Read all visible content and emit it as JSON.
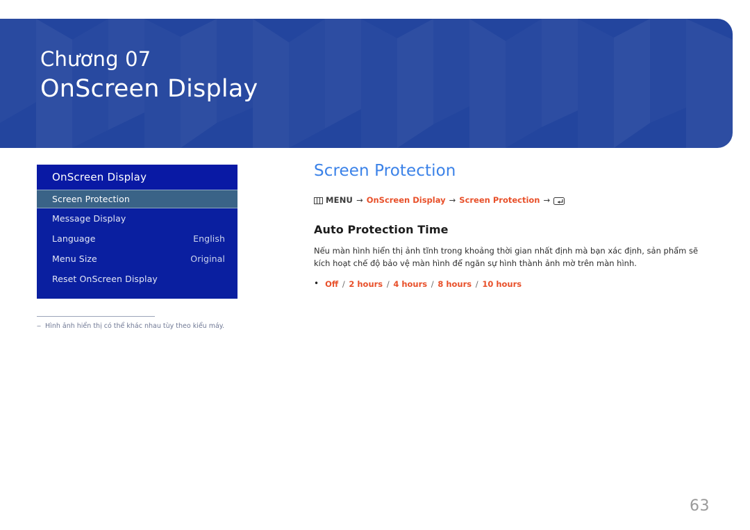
{
  "banner": {
    "chapter_label": "Chương 07",
    "chapter_title": "OnScreen Display",
    "background_color": "#23459e"
  },
  "osd_menu": {
    "header": "OnScreen Display",
    "rows": [
      {
        "label": "Screen Protection",
        "value": "",
        "selected": true
      },
      {
        "label": "Message Display",
        "value": "",
        "selected": false
      },
      {
        "label": "Language",
        "value": "English",
        "selected": false
      },
      {
        "label": "Menu Size",
        "value": "Original",
        "selected": false
      },
      {
        "label": "Reset OnScreen Display",
        "value": "",
        "selected": false
      }
    ],
    "background_color": "#0a1fa0",
    "selected_color": "#3a6387"
  },
  "footnote": {
    "dash": "‒",
    "text": "Hình ảnh hiển thị có thể khác nhau tùy theo kiểu máy."
  },
  "content": {
    "section_title": "Screen Protection",
    "section_title_color": "#3b82e8",
    "breadcrumb": {
      "menu_icon": "menu-icon",
      "menu_label": "MENU",
      "arrow": "→",
      "link_1": "OnScreen Display",
      "link_2": "Screen Protection",
      "enter_icon": "enter-key-icon",
      "link_color": "#e8502a"
    },
    "sub_title": "Auto Protection Time",
    "body_text": "Nếu màn hình hiển thị ảnh tĩnh trong khoảng thời gian nhất định mà bạn xác định, sản phẩm sẽ kích hoạt chế độ bảo vệ màn hình để ngăn sự hình thành ảnh mờ trên màn hình.",
    "options": {
      "bullet": "•",
      "values": [
        "Off",
        "2 hours",
        "4 hours",
        "8 hours",
        "10 hours"
      ],
      "separator": "/"
    }
  },
  "page_number": "63"
}
